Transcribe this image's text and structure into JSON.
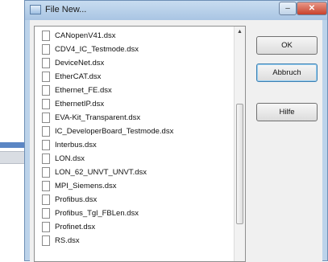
{
  "window": {
    "title": "File New..."
  },
  "file_list": {
    "items": [
      "CANopenV41.dsx",
      "CDV4_IC_Testmode.dsx",
      "DeviceNet.dsx",
      "EtherCAT.dsx",
      "Ethernet_FE.dsx",
      "EthernetIP.dsx",
      "EVA-Kit_Transparent.dsx",
      "IC_DeveloperBoard_Testmode.dsx",
      "Interbus.dsx",
      "LON.dsx",
      "LON_62_UNVT_UNVT.dsx",
      "MPI_Siemens.dsx",
      "Profibus.dsx",
      "Profibus_Tgl_FBLen.dsx",
      "Profinet.dsx",
      "RS.dsx"
    ]
  },
  "buttons": {
    "ok": "OK",
    "cancel": "Abbruch",
    "help": "Hilfe"
  }
}
